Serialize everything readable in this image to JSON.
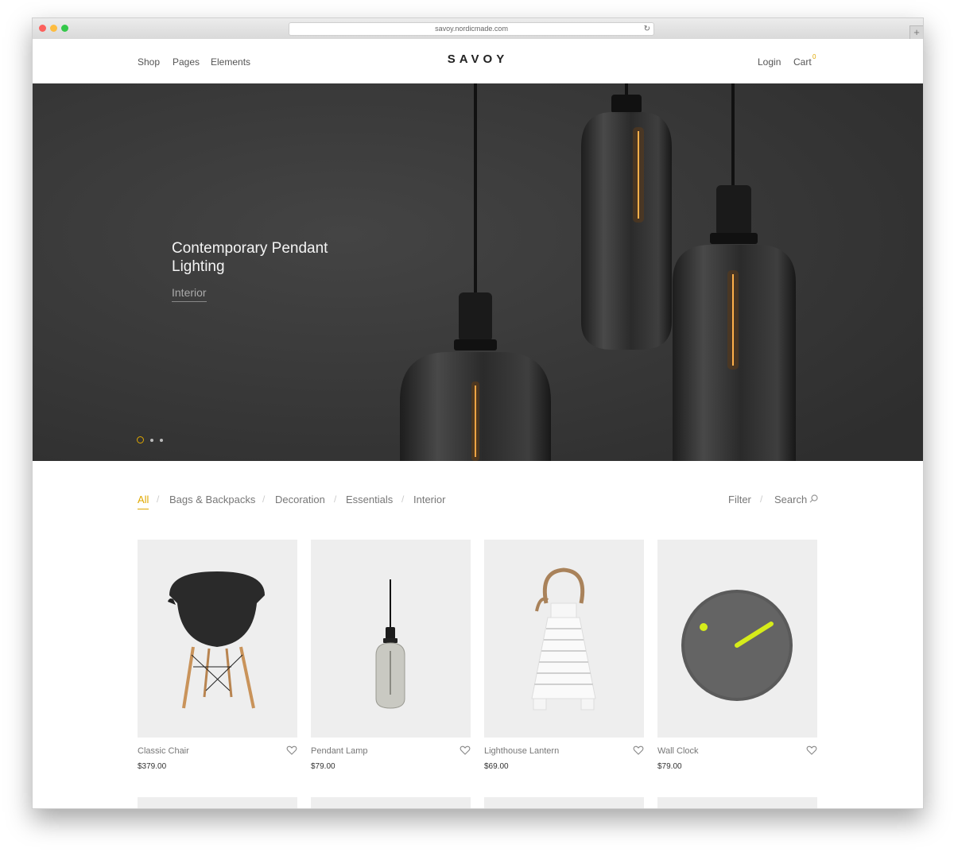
{
  "browser": {
    "url": "savoy.nordicmade.com",
    "reload_glyph": "↻",
    "new_tab_glyph": "+",
    "colors": {
      "close": "#fc605c",
      "minimize": "#fdbc40",
      "maximize": "#34c84a"
    }
  },
  "header": {
    "nav": {
      "shop": "Shop",
      "pages": "Pages",
      "elements": "Elements"
    },
    "logo": "SAVOY",
    "login": "Login",
    "cart": "Cart",
    "cart_count": "0"
  },
  "hero": {
    "title": "Contemporary Pendant Lighting",
    "subtitle": "Interior",
    "slide_count": 3,
    "active_slide": 1
  },
  "filters": {
    "categories": [
      "All",
      "Bags & Backpacks",
      "Decoration",
      "Essentials",
      "Interior"
    ],
    "active": "All",
    "separator": "/",
    "filter_label": "Filter",
    "search_label": "Search"
  },
  "products": [
    {
      "name": "Classic Chair",
      "price": "$379.00",
      "icon": "chair-image"
    },
    {
      "name": "Pendant Lamp",
      "price": "$79.00",
      "icon": "pendant-lamp-image"
    },
    {
      "name": "Lighthouse Lantern",
      "price": "$69.00",
      "icon": "lantern-image"
    },
    {
      "name": "Wall Clock",
      "price": "$79.00",
      "icon": "wall-clock-image"
    }
  ],
  "colors": {
    "accent": "#e0a800",
    "hero_bg": "#3b3b3b",
    "tile_bg": "#eeeeee"
  }
}
